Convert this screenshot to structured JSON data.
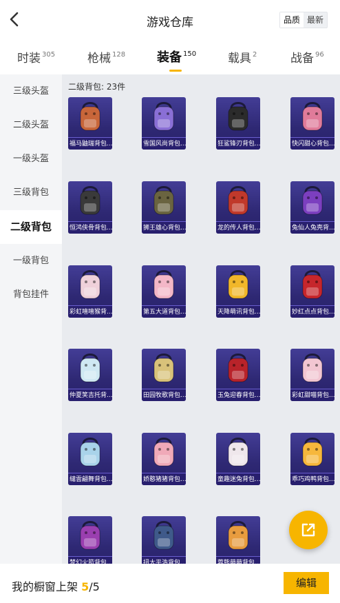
{
  "header": {
    "title": "游戏仓库",
    "sort": [
      "品质",
      "最新"
    ],
    "sort_selected": "品质"
  },
  "tabs": [
    {
      "label": "时装",
      "count": "305"
    },
    {
      "label": "枪械",
      "count": "128"
    },
    {
      "label": "装备",
      "count": "150"
    },
    {
      "label": "载具",
      "count": "2"
    },
    {
      "label": "战备",
      "count": "96"
    }
  ],
  "active_tab": "装备",
  "sidebar": {
    "items": [
      "三级头盔",
      "二级头盔",
      "一级头盔",
      "三级背包",
      "二级背包",
      "一级背包",
      "背包挂件"
    ],
    "active": "二级背包"
  },
  "section": {
    "title": "二级背包: 23件"
  },
  "items": [
    {
      "name": "福马鼬瑞背包...",
      "color": "#c8663a"
    },
    {
      "name": "雪国风尚背包...",
      "color": "#8a6fd6"
    },
    {
      "name": "狂鲨锋刃背包...",
      "color": "#2b2b2b"
    },
    {
      "name": "快闪甜心背包...",
      "color": "#e07b9a"
    },
    {
      "name": "恒鸿侠骨背包...",
      "color": "#3a3a3a"
    },
    {
      "name": "狮王雄心背包...",
      "color": "#6a6440"
    },
    {
      "name": "龙的传人背包...",
      "color": "#c0392b"
    },
    {
      "name": "兔仙人兔壳背...",
      "color": "#7c3fbf"
    },
    {
      "name": "彩虹嘻嘻猴背...",
      "color": "#efd1da"
    },
    {
      "name": "第五大道背包...",
      "color": "#f3b7c7"
    },
    {
      "name": "天降萌讯背包...",
      "color": "#f1b72a"
    },
    {
      "name": "妙红点点背包...",
      "color": "#c6262c"
    },
    {
      "name": "仲夏笑吉托背...",
      "color": "#cfe8f3"
    },
    {
      "name": "田园牧歌背包...",
      "color": "#d9c27a"
    },
    {
      "name": "玉兔迎春背包...",
      "color": "#b8232a"
    },
    {
      "name": "彩虹甜喵背包...",
      "color": "#f2c6d2"
    },
    {
      "name": "缱雲翩舞背包...",
      "color": "#a9d3ea"
    },
    {
      "name": "娇憨猪猪背包...",
      "color": "#f0a9b8"
    },
    {
      "name": "童趣迷兔背包...",
      "color": "#efe7ec"
    },
    {
      "name": "乖巧鸡鸭背包...",
      "color": "#f6b73c"
    },
    {
      "name": "梦幻火箭背包...",
      "color": "#9a3fb0"
    },
    {
      "name": "扭大平浩背包...",
      "color": "#3f5a8a"
    },
    {
      "name": "蓉熊萌萌背包...",
      "color": "#e89c3f"
    }
  ],
  "bottom": {
    "shelf_label": "我的橱窗上架",
    "shelf_used": "5",
    "shelf_total": "/5",
    "edit_label": "编辑"
  },
  "icons": {
    "back": "chevron-left-icon",
    "share": "external-link-icon"
  },
  "colors": {
    "accent": "#f7b500",
    "card": "#2e2873"
  }
}
